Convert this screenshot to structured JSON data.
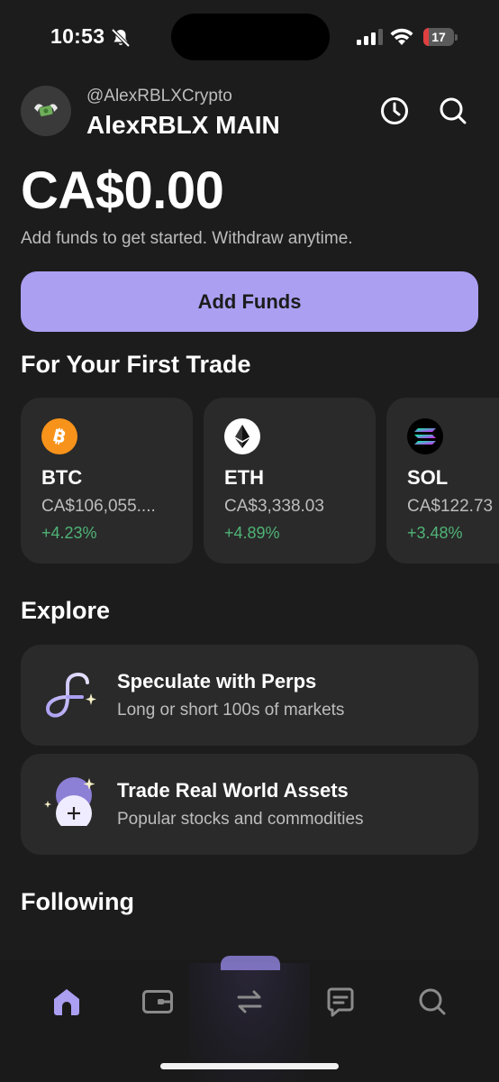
{
  "status_bar": {
    "time": "10:53",
    "battery_level": "17",
    "battery_fraction": 0.17,
    "battery_color": "#e04040"
  },
  "header": {
    "handle": "@AlexRBLXCrypto",
    "account_name": "AlexRBLX MAIN",
    "history_icon": "clock-icon",
    "search_icon": "search-icon"
  },
  "balance": {
    "amount": "CA$0.00",
    "subtitle": "Add funds to get started. Withdraw anytime."
  },
  "add_funds": {
    "label": "Add Funds",
    "color": "#ab9ff2"
  },
  "first_trade": {
    "title": "For Your First Trade",
    "assets": [
      {
        "symbol": "BTC",
        "price": "CA$106,055....",
        "change": "+4.23%",
        "icon": "bitcoin-icon",
        "icon_color": "#f7931a"
      },
      {
        "symbol": "ETH",
        "price": "CA$3,338.03",
        "change": "+4.89%",
        "icon": "ethereum-icon",
        "icon_color": "#ffffff"
      },
      {
        "symbol": "SOL",
        "price": "CA$122.73",
        "change": "+3.48%",
        "icon": "solana-icon",
        "icon_color": "#000000"
      }
    ],
    "positive_color": "#4fb477"
  },
  "explore": {
    "title": "Explore",
    "items": [
      {
        "title": "Speculate with Perps",
        "description": "Long or short 100s of markets",
        "icon": "perps-icon"
      },
      {
        "title": "Trade Real World Assets",
        "description": "Popular stocks and commodities",
        "icon": "rwa-icon"
      }
    ]
  },
  "following": {
    "title": "Following"
  },
  "bottom_nav": {
    "items": [
      {
        "name": "home",
        "icon": "home-icon",
        "active": true
      },
      {
        "name": "wallet",
        "icon": "wallet-icon",
        "active": false
      },
      {
        "name": "swap",
        "icon": "swap-icon",
        "active": false
      },
      {
        "name": "messages",
        "icon": "chat-icon",
        "active": false
      },
      {
        "name": "explore",
        "icon": "search-icon",
        "active": false
      }
    ],
    "active_color": "#ab9ff2",
    "inactive_color": "#8a8a8a"
  }
}
